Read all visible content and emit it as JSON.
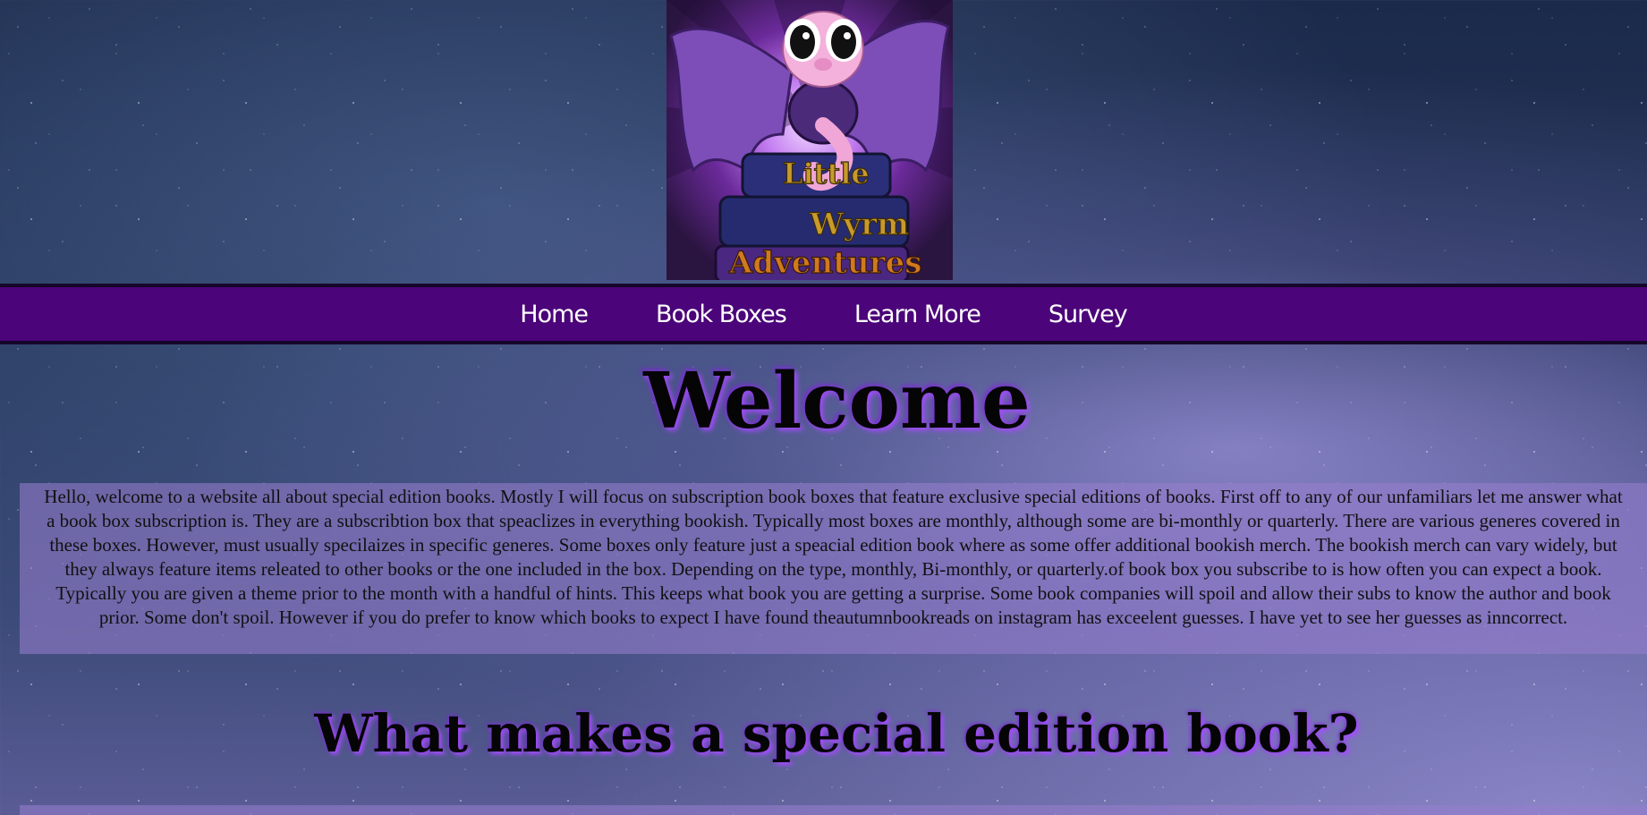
{
  "logo": {
    "line1": "Little",
    "line2": "Wyrm",
    "line3": "Adventures"
  },
  "nav": {
    "items": [
      {
        "label": "Home"
      },
      {
        "label": "Book Boxes"
      },
      {
        "label": "Learn More"
      },
      {
        "label": "Survey"
      }
    ]
  },
  "main": {
    "welcome_title": "Welcome",
    "intro_text": "Hello, welcome to a website all about special edition books. Mostly I will focus on subscription book boxes that feature exclusive special editions of books. First off to any of our unfamiliars let me answer what a book box subscription is. They are a subscribtion box that speaclizes in everything bookish. Typically most boxes are monthly, although some are bi-monthly or quarterly. There are various generes covered in these boxes. However, must usually specilaizes in specific generes. Some boxes only feature just a speacial edition book where as some offer additional bookish merch. The bookish merch can vary widely, but they always feature items releated to other books or the one included in the box. Depending on the type, monthly, Bi-monthly, or quarterly.of book box you subscribe to is how often you can expect a book. Typically you are given a theme prior to the month with a handful of hints. This keeps what book you are getting a surprise. Some book companies will spoil and allow their subs to know the author and book prior. Some don't spoil. However if you do prefer to know which books to expect I have found theautumnbookreads on instagram has exceelent guesses. I have yet to see her guesses as inncorrect.",
    "section_title": "What makes a special edition book?"
  }
}
